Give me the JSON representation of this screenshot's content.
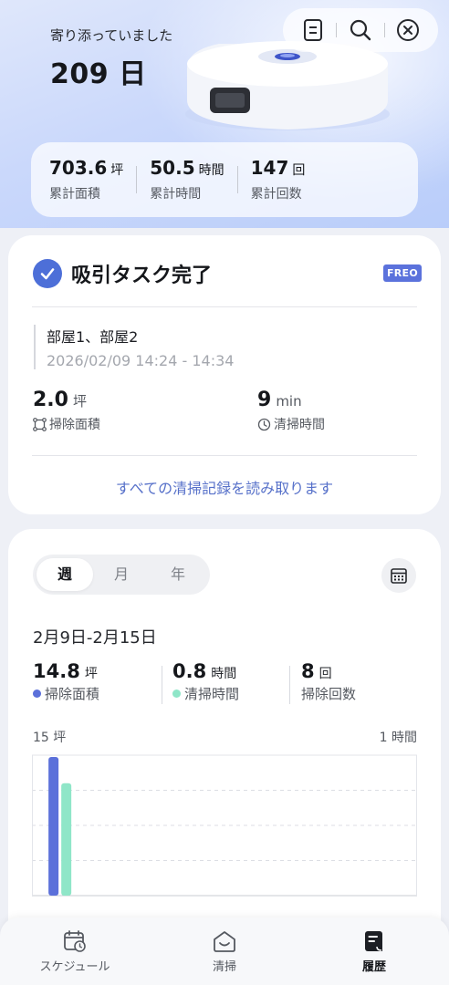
{
  "hero": {
    "subtitle": "寄り添っていました",
    "days": "209 日",
    "stats": [
      {
        "value": "703.6",
        "unit": "坪",
        "label": "累計面積"
      },
      {
        "value": "50.5",
        "unit": "時間",
        "label": "累計時間"
      },
      {
        "value": "147",
        "unit": "回",
        "label": "累計回数"
      }
    ]
  },
  "task": {
    "title": "吸引タスク完了",
    "badge": "FREO",
    "rooms": "部屋1、部屋2",
    "time_range": "2026/02/09 14:24 - 14:34",
    "area_value": "2.0",
    "area_unit": "坪",
    "area_label": "掃除面積",
    "duration_value": "9",
    "duration_unit": "min",
    "duration_label": "清掃時間",
    "read_all": "すべての清掃記録を読み取ります"
  },
  "stats": {
    "tabs": [
      "週",
      "月",
      "年"
    ],
    "active_tab": "週",
    "range": "2月9日-2月15日",
    "area": {
      "value": "14.8",
      "unit": "坪",
      "label": "掃除面積"
    },
    "time": {
      "value": "0.8",
      "unit": "時間",
      "label": "清掃時間"
    },
    "count": {
      "value": "8",
      "unit": "回",
      "label": "掃除回数"
    },
    "colors": {
      "area": "#5b70da",
      "time": "#8fe6c8"
    }
  },
  "chart_data": {
    "type": "bar",
    "left_axis_label": "15 坪",
    "right_axis_label": "1 時間",
    "series": [
      {
        "values": [
          14.8,
          0,
          0,
          0,
          0,
          0,
          0
        ],
        "ylim": [
          0,
          15
        ]
      },
      {
        "values": [
          0.8,
          0,
          0,
          0,
          0,
          0,
          0
        ],
        "ylim": [
          0,
          1
        ]
      }
    ],
    "categories_count": 7,
    "grid": true
  },
  "nav": {
    "items": [
      {
        "label": "スケジュール",
        "icon": "calendar-clock-icon"
      },
      {
        "label": "清掃",
        "icon": "home-icon"
      },
      {
        "label": "履歴",
        "icon": "history-doc-icon"
      }
    ],
    "active": "履歴"
  }
}
